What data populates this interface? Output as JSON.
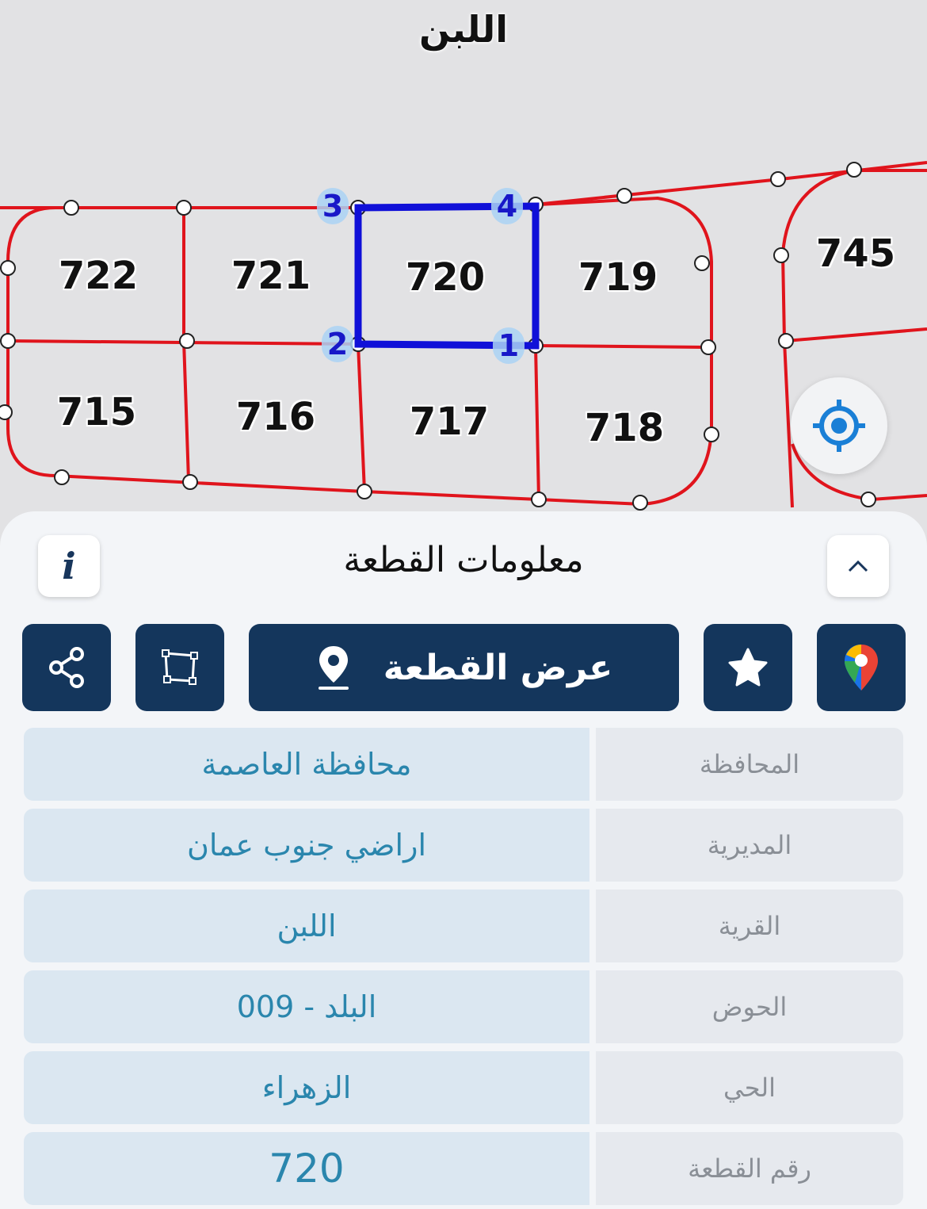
{
  "map": {
    "area_title": "اللبن",
    "plots": [
      {
        "label": "722"
      },
      {
        "label": "721"
      },
      {
        "label": "720"
      },
      {
        "label": "719"
      },
      {
        "label": "745"
      },
      {
        "label": "715"
      },
      {
        "label": "716"
      },
      {
        "label": "717"
      },
      {
        "label": "718"
      }
    ],
    "corners": [
      "1",
      "2",
      "3",
      "4"
    ],
    "colors": {
      "boundary": "#e0141c",
      "selected": "#1010d8",
      "background": "#e2e2e4"
    }
  },
  "sheet": {
    "title": "معلومات القطعة",
    "actions": {
      "show_plot_label": "عرض القطعة"
    },
    "rows": [
      {
        "label": "المحافظة",
        "value": "محافظة العاصمة"
      },
      {
        "label": "المديرية",
        "value": "اراضي جنوب عمان"
      },
      {
        "label": "القرية",
        "value": "اللبن"
      },
      {
        "label": "الحوض",
        "value": "البلد - 009"
      },
      {
        "label": "الحي",
        "value": "الزهراء"
      },
      {
        "label": "رقم القطعة",
        "value": "720"
      }
    ],
    "colors": {
      "button": "#14365c",
      "value_text": "#2a86ad",
      "label_text": "#8a8f96"
    }
  }
}
